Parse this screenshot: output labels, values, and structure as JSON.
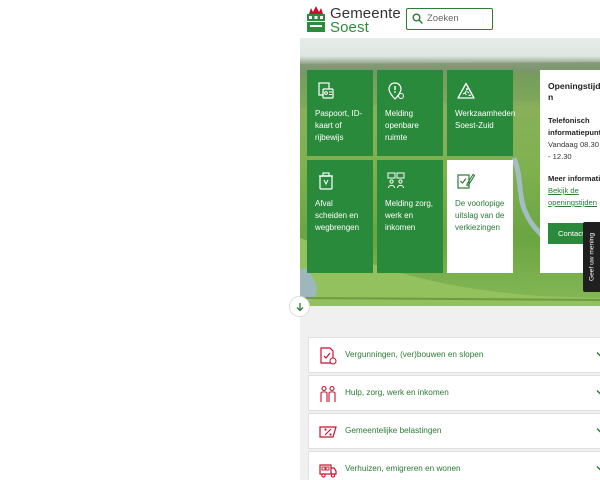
{
  "header": {
    "logo_line1": "Gemeente",
    "logo_line2": "Soest",
    "search_placeholder": "Zoeken",
    "search_icon": "search-icon"
  },
  "tiles": [
    {
      "label": "Paspoort, ID-kaart of rijbewijs",
      "icon": "id-card-icon"
    },
    {
      "label": "Melding openbare ruimte",
      "icon": "location-alert-icon"
    },
    {
      "label": "Werkzaamheden Soest-Zuid",
      "icon": "roadworks-icon"
    },
    {
      "label": "Afval scheiden en wegbrengen",
      "icon": "waste-bin-icon"
    },
    {
      "label": "Melding zorg, werk en inkomen",
      "icon": "people-care-icon"
    },
    {
      "label": "De voorlopige uitslag van de verkiezingen",
      "icon": "ballot-vote-icon"
    }
  ],
  "opening_panel": {
    "title_part1": "Openingstijde",
    "title_part2": "n",
    "sub_line1": "Telefonisch",
    "sub_line2": "informatiepunt",
    "hours_line1": "Vandaag 08.30",
    "hours_line2": "- 12.30",
    "more_label": "Meer informati",
    "link_line1": "Bekijk de",
    "link_line2": "openingstijden",
    "contact_button": "Contact"
  },
  "feedback_tab": "Geef uw mening",
  "accordion": [
    {
      "label": "Vergunningen, (ver)bouwen en slopen",
      "icon": "permit-document-icon"
    },
    {
      "label": "Hulp, zorg, werk en inkomen",
      "icon": "people-help-icon"
    },
    {
      "label": "Gemeentelijke belastingen",
      "icon": "tax-percent-icon"
    },
    {
      "label": "Verhuizen, emigreren en wonen",
      "icon": "moving-truck-icon"
    }
  ],
  "colors": {
    "brand_green": "#2a8a3b",
    "link_green": "#2a7a34",
    "accent_red": "#c8102e"
  }
}
